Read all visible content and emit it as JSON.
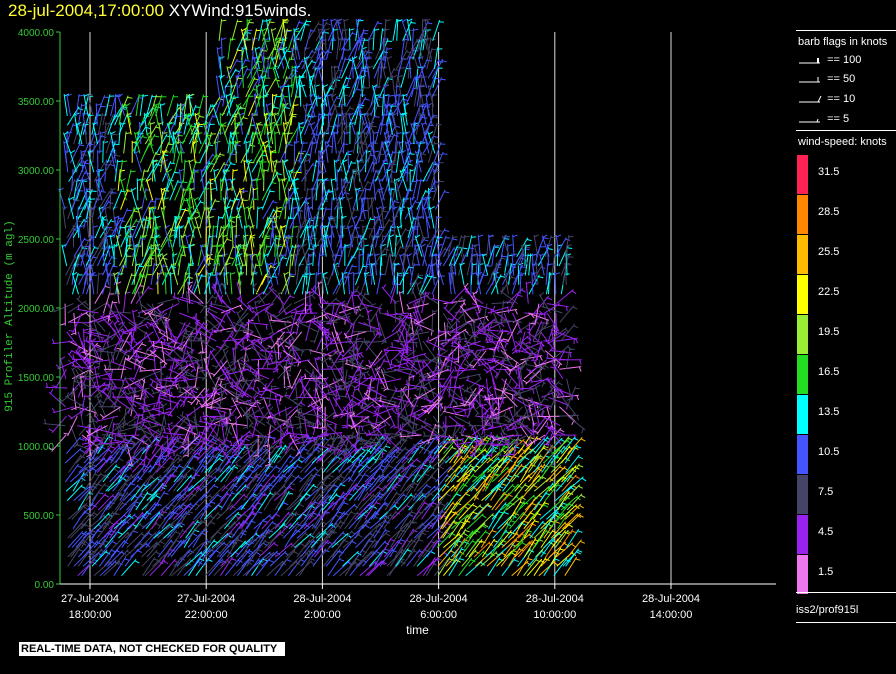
{
  "header": {
    "timestamp": "28-jul-2004,17:00:00",
    "product": "XYWind:915winds."
  },
  "chart_data": {
    "type": "wind-barb time-height",
    "ylabel": "915 Profiler Altitude (m agl)",
    "xlabel": "time",
    "ylim": [
      0,
      4000
    ],
    "y_ticks": [
      "0.00",
      "500.00",
      "1000.00",
      "1500.00",
      "2000.00",
      "2500.00",
      "3000.00",
      "3500.00",
      "4000.00"
    ],
    "x_ticks": [
      {
        "date": "27-Jul-2004",
        "time": "18:00:00"
      },
      {
        "date": "27-Jul-2004",
        "time": "22:00:00"
      },
      {
        "date": "28-Jul-2004",
        "time": "2:00:00"
      },
      {
        "date": "28-Jul-2004",
        "time": "6:00:00"
      },
      {
        "date": "28-Jul-2004",
        "time": "10:00:00"
      },
      {
        "date": "28-Jul-2004",
        "time": "14:00:00"
      }
    ],
    "time_range_hours_from_first_tick": [
      -1,
      16.6
    ],
    "grid": "vertical lines at time ticks",
    "wind_speed_scale_knots": [
      {
        "value": "31.5",
        "color": "#ff2255"
      },
      {
        "value": "28.5",
        "color": "#ff8800"
      },
      {
        "value": "25.5",
        "color": "#ffbb00"
      },
      {
        "value": "22.5",
        "color": "#ffff00"
      },
      {
        "value": "19.5",
        "color": "#99ee33"
      },
      {
        "value": "16.5",
        "color": "#22dd22"
      },
      {
        "value": "13.5",
        "color": "#00ffff"
      },
      {
        "value": "10.5",
        "color": "#4455ff"
      },
      {
        "value": "7.5",
        "color": "#444466"
      },
      {
        "value": "4.5",
        "color": "#9922ee"
      },
      {
        "value": "1.5",
        "color": "#ee77ee"
      }
    ]
  },
  "legend": {
    "flags_title": "barb flags in knots",
    "flags": [
      "== 100",
      "== 50",
      "== 10",
      "== 5"
    ],
    "speed_title": "wind-speed: knots",
    "source": "iss2/prof915l"
  },
  "footer": {
    "disclaimer": "REAL-TIME DATA, NOT CHECKED FOR QUALITY"
  },
  "colors": {
    "axis": "#33cc33",
    "title_timestamp": "#ffff33",
    "background": "#000000"
  }
}
